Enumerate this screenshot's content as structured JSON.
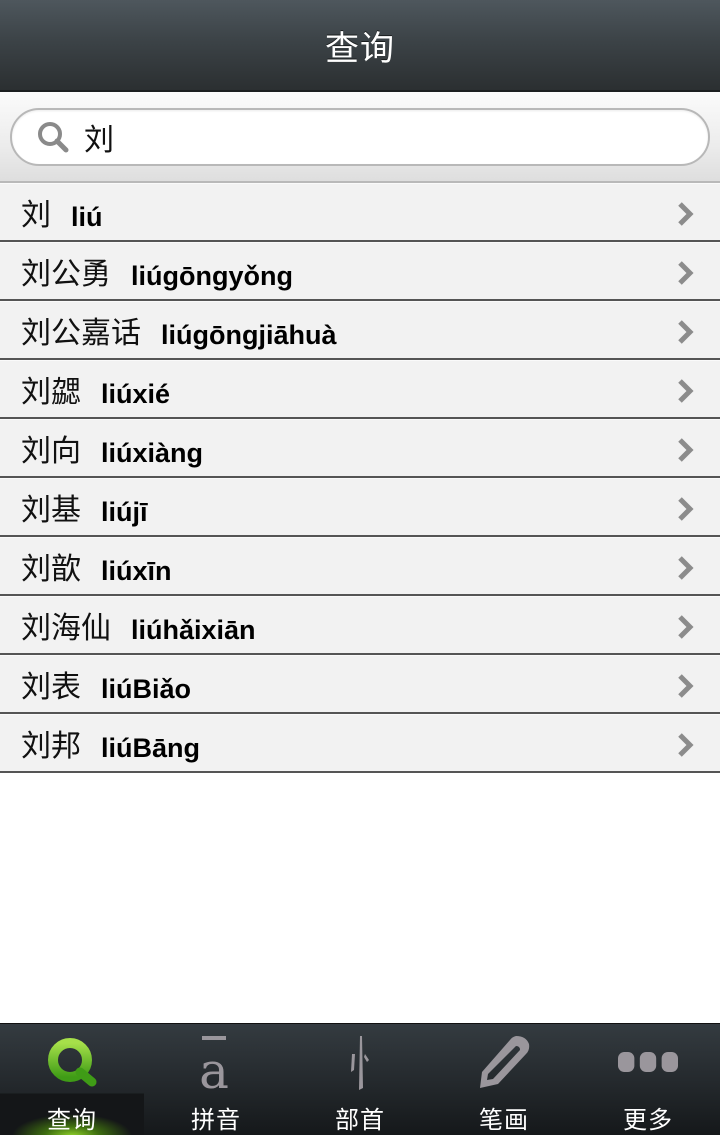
{
  "header": {
    "title": "查询"
  },
  "search": {
    "value": "刘",
    "icon": "search-icon"
  },
  "results": [
    {
      "word": "刘",
      "pinyin": "liú"
    },
    {
      "word": "刘公勇",
      "pinyin": "liúgōngyǒng"
    },
    {
      "word": "刘公嘉话",
      "pinyin": "liúgōngjiāhuà"
    },
    {
      "word": "刘勰",
      "pinyin": "liúxié"
    },
    {
      "word": "刘向",
      "pinyin": "liúxiàng"
    },
    {
      "word": "刘基",
      "pinyin": "liújī"
    },
    {
      "word": "刘歆",
      "pinyin": "liúxīn"
    },
    {
      "word": "刘海仙",
      "pinyin": "liúhǎixiān"
    },
    {
      "word": "刘表",
      "pinyin": "liúBiǎo"
    },
    {
      "word": "刘邦",
      "pinyin": "liúBāng"
    }
  ],
  "tabs": [
    {
      "label": "查询",
      "icon": "search-icon",
      "active": true
    },
    {
      "label": "拼音",
      "icon": "pinyin-a-icon",
      "active": false
    },
    {
      "label": "部首",
      "icon": "radical-icon",
      "active": false
    },
    {
      "label": "笔画",
      "icon": "pencil-icon",
      "active": false
    },
    {
      "label": "更多",
      "icon": "more-dots-icon",
      "active": false
    }
  ],
  "colors": {
    "active_tab": "#5fb51e",
    "inactive_icon": "#9a969c",
    "header_bg": "#3c4347",
    "row_bg": "#f2f2f2"
  }
}
